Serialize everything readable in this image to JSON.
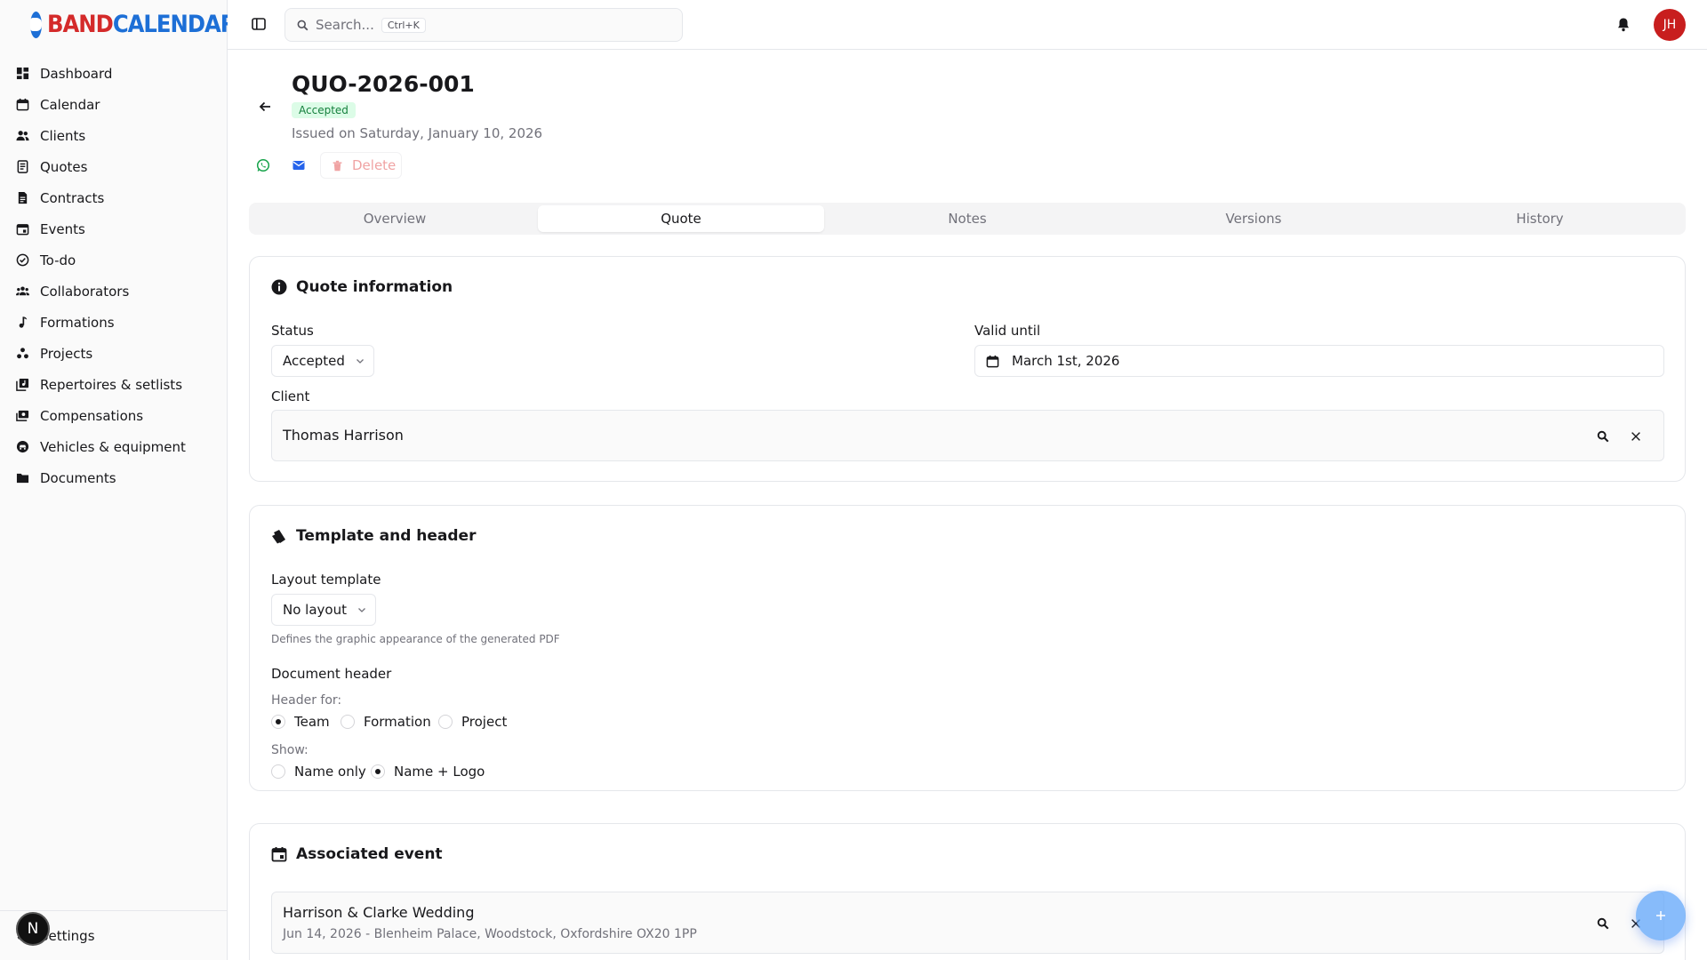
{
  "brand": {
    "part1": "BAND",
    "part2": "CALENDAR"
  },
  "sidebar": {
    "items": [
      {
        "label": "Dashboard",
        "icon": "dashboard-icon"
      },
      {
        "label": "Calendar",
        "icon": "calendar-icon"
      },
      {
        "label": "Clients",
        "icon": "users-icon"
      },
      {
        "label": "Quotes",
        "icon": "quote-icon"
      },
      {
        "label": "Contracts",
        "icon": "contract-icon"
      },
      {
        "label": "Events",
        "icon": "event-icon"
      },
      {
        "label": "To-do",
        "icon": "check-circle-icon"
      },
      {
        "label": "Collaborators",
        "icon": "collaborators-icon"
      },
      {
        "label": "Formations",
        "icon": "music-note-icon"
      },
      {
        "label": "Projects",
        "icon": "projects-icon"
      },
      {
        "label": "Repertoires & setlists",
        "icon": "library-icon"
      },
      {
        "label": "Compensations",
        "icon": "money-icon"
      },
      {
        "label": "Vehicles & equipment",
        "icon": "vehicle-icon"
      },
      {
        "label": "Documents",
        "icon": "folder-icon"
      }
    ],
    "settings_label": "Settings",
    "n_badge": "N"
  },
  "topbar": {
    "search_placeholder": "Search...",
    "shortcut": "Ctrl+K",
    "avatar_initials": "JH"
  },
  "quote": {
    "number": "QUO-2026-001",
    "status_badge": "Accepted",
    "issued": "Issued on Saturday, January 10, 2026",
    "delete_label": "Delete"
  },
  "tabs": [
    "Overview",
    "Quote",
    "Notes",
    "Versions",
    "History"
  ],
  "active_tab": "Quote",
  "quote_info": {
    "title": "Quote information",
    "status_label": "Status",
    "status_value": "Accepted",
    "valid_label": "Valid until",
    "valid_value": "March 1st, 2026",
    "client_label": "Client",
    "client_value": "Thomas Harrison"
  },
  "template": {
    "title": "Template and header",
    "layout_label": "Layout template",
    "layout_value": "No layout",
    "layout_hint": "Defines the graphic appearance of the generated PDF",
    "doc_header_label": "Document header",
    "header_for_label": "Header for:",
    "header_for_options": [
      "Team",
      "Formation",
      "Project"
    ],
    "header_for_selected": "Team",
    "show_label": "Show:",
    "show_options": [
      "Name only",
      "Name + Logo"
    ],
    "show_selected": "Name + Logo"
  },
  "event": {
    "title": "Associated event",
    "name": "Harrison & Clarke Wedding",
    "details": "Jun 14, 2026 - Blenheim Palace, Woodstock, Oxfordshire OX20 1PP"
  },
  "colors": {
    "accent": "#1d6fd6",
    "brand_red": "#d42a2a",
    "success_bg": "#dcfce7",
    "success_text": "#15803d",
    "avatar": "#c81e1e"
  }
}
